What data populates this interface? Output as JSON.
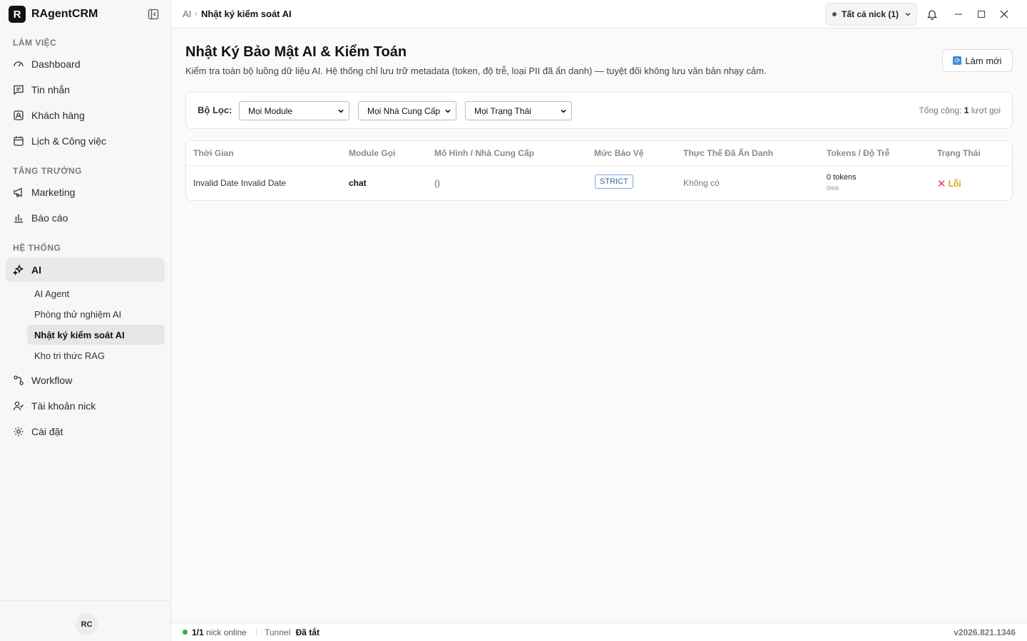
{
  "app": {
    "logo_letter": "R",
    "name": "RAgentCRM"
  },
  "sidebar": {
    "sections": {
      "work": "LÀM VIỆC",
      "growth": "TĂNG TRƯỞNG",
      "system": "HỆ THỐNG"
    },
    "items": {
      "dashboard": "Dashboard",
      "messages": "Tin nhắn",
      "customers": "Khách hàng",
      "calendar": "Lịch & Công việc",
      "marketing": "Marketing",
      "reports": "Báo cáo",
      "ai": "AI",
      "workflow": "Workflow",
      "accounts": "Tài khoản nick",
      "settings": "Cài đặt"
    },
    "ai_sub": {
      "agent": "AI Agent",
      "lab": "Phòng thử nghiệm AI",
      "audit": "Nhật ký kiểm soát AI",
      "rag": "Kho tri thức RAG"
    },
    "avatar": "RC"
  },
  "topbar": {
    "breadcrumb_parent": "AI",
    "breadcrumb_sep": "›",
    "breadcrumb_current": "Nhật ký kiểm soát AI",
    "nick_select": "Tất cả nick (1)"
  },
  "page": {
    "title": "Nhật Ký Bảo Mật AI & Kiểm Toán",
    "description": "Kiểm tra toàn bộ luồng dữ liệu AI. Hệ thống chỉ lưu trữ metadata (token, độ trễ, loại PII đã ẩn danh) — tuyệt đối không lưu văn bản nhạy cảm.",
    "refresh_label": "Làm mới"
  },
  "filters": {
    "label": "Bộ Lọc:",
    "module": "Mọi Module",
    "provider": "Mọi Nhà Cung Cấp",
    "status": "Mọi Trạng Thái",
    "total_prefix": "Tổng cộng:",
    "total_count": "1",
    "total_suffix": "lượt gọi"
  },
  "table": {
    "headers": {
      "time": "Thời Gian",
      "module": "Module Gọi",
      "model": "Mô Hình / Nhà Cung Cấp",
      "protection": "Mức Bảo Vệ",
      "entities": "Thực Thể Đã Ẩn Danh",
      "tokens": "Tokens / Độ Trễ",
      "status": "Trạng Thái"
    },
    "rows": [
      {
        "time": "Invalid Date Invalid Date",
        "module": "chat",
        "model": "()",
        "protection": "STRICT",
        "entities": "Không có",
        "tokens": "0 tokens",
        "latency": "0ms",
        "status": "Lỗi"
      }
    ]
  },
  "statusbar": {
    "online_count": "1/1",
    "online_label": "nick online",
    "tunnel_label": "Tunnel",
    "tunnel_value": "Đã tắt",
    "version": "v2026.821.1346"
  },
  "colors": {
    "online": "#2bb34a",
    "error_x": "#e2345a",
    "error_text": "#e0a100",
    "strict": "#2f68b0"
  }
}
